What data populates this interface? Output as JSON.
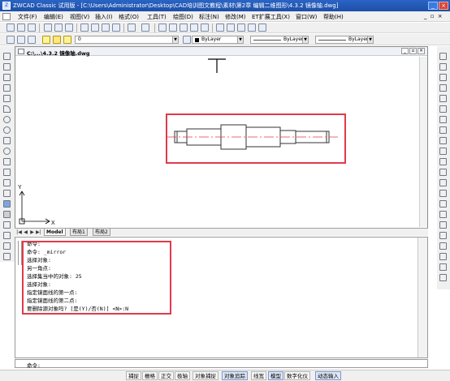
{
  "window": {
    "title": "ZWCAD Classic 试用版 - [C:\\Users\\Administrator\\Desktop\\CAD培训图文教程\\素材\\第2章 编辑二维图形\\4.3.2 镜像轴.dwg]",
    "app_icon_label": "Z",
    "minimize_label": "_",
    "close_label": "×"
  },
  "menubar": {
    "items": [
      "文件(F)",
      "编辑(E)",
      "视图(V)",
      "插入(I)",
      "格式(O)",
      "工具(T)",
      "绘图(D)",
      "标注(N)",
      "修改(M)",
      "ET扩展工具(X)",
      "窗口(W)",
      "帮助(H)"
    ],
    "right_controls": "_ ▫ ×"
  },
  "toolbars": {
    "layer_value": "0",
    "color_value": "ByLayer",
    "linetype_value": "ByLayer",
    "lineweight_value": "ByLayer"
  },
  "drawing": {
    "tab_title": "C:\\...\\4.3.2 镜像轴.dwg",
    "ucs_y_label": "Y",
    "ucs_x_label": "X",
    "header_controls": [
      "_",
      "▫",
      "×"
    ]
  },
  "layout_tabs": {
    "nav": [
      "|◀",
      "◀",
      "▶",
      "▶|"
    ],
    "tabs": [
      "Model",
      "布局1",
      "布局2"
    ],
    "active": "Model"
  },
  "command": {
    "history": [
      "命令:",
      "命令: _mirror",
      "选择对象:",
      "另一角点:",
      "选择集当中的对象: 25",
      "选择对象:",
      "指定镜面线的第一点:",
      "指定镜面线的第二点:",
      "要删除源对象吗? [是(Y)/否(N)] <N>:N"
    ],
    "prompt": "命令:"
  },
  "statusbar": {
    "coords": "",
    "buttons": [
      {
        "label": "捕捉",
        "on": false
      },
      {
        "label": "栅格",
        "on": false
      },
      {
        "label": "正交",
        "on": false
      },
      {
        "label": "极轴",
        "on": false
      },
      {
        "label": "对象捕捉",
        "on": false
      },
      {
        "label": "对象追踪",
        "on": true
      },
      {
        "label": "线宽",
        "on": false
      },
      {
        "label": "模型",
        "on": true
      },
      {
        "label": "数字化仪",
        "on": false
      },
      {
        "label": "动态输入",
        "on": true
      }
    ]
  },
  "colors": {
    "highlight": "#e03a4a",
    "centerline": "#e03a4a",
    "titlebar": "#1d4fa8"
  }
}
